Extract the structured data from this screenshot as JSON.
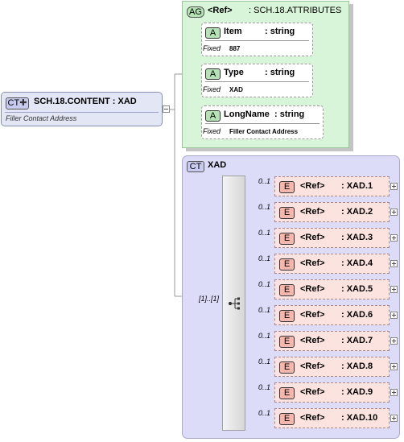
{
  "root": {
    "badge": "CT",
    "name": "SCH.18.CONTENT : XAD",
    "doc": "Filler Contact Address"
  },
  "attributes_group": {
    "badge": "AG",
    "ref": "<Ref>",
    "name": ": SCH.18.ATTRIBUTES",
    "attributes": [
      {
        "badge": "A",
        "name": "Item",
        "type": ": string",
        "fixed_label": "Fixed",
        "fixed_value": "887"
      },
      {
        "badge": "A",
        "name": "Type",
        "type": ": string",
        "fixed_label": "Fixed",
        "fixed_value": "XAD"
      },
      {
        "badge": "A",
        "name": "LongName",
        "type": ": string",
        "fixed_label": "Fixed",
        "fixed_value": "Filler Contact Address"
      }
    ]
  },
  "complex_type": {
    "badge": "CT",
    "name": "XAD",
    "sequence_multiplicity": "[1]..[1]",
    "elements": [
      {
        "badge": "E",
        "ref": "<Ref>",
        "name": ": XAD.1",
        "mult": "0..1"
      },
      {
        "badge": "E",
        "ref": "<Ref>",
        "name": ": XAD.2",
        "mult": "0..1"
      },
      {
        "badge": "E",
        "ref": "<Ref>",
        "name": ": XAD.3",
        "mult": "0..1"
      },
      {
        "badge": "E",
        "ref": "<Ref>",
        "name": ": XAD.4",
        "mult": "0..1"
      },
      {
        "badge": "E",
        "ref": "<Ref>",
        "name": ": XAD.5",
        "mult": "0..1"
      },
      {
        "badge": "E",
        "ref": "<Ref>",
        "name": ": XAD.6",
        "mult": "0..1"
      },
      {
        "badge": "E",
        "ref": "<Ref>",
        "name": ": XAD.7",
        "mult": "0..1"
      },
      {
        "badge": "E",
        "ref": "<Ref>",
        "name": ": XAD.8",
        "mult": "0..1"
      },
      {
        "badge": "E",
        "ref": "<Ref>",
        "name": ": XAD.9",
        "mult": "0..1"
      },
      {
        "badge": "E",
        "ref": "<Ref>",
        "name": ": XAD.10",
        "mult": "0..1"
      }
    ]
  },
  "colors": {
    "root_fill": "#e3e6f5",
    "group_fill": "#d9f5d9",
    "attr_fill": "#ffffff",
    "ct_fill": "#dcdcf8",
    "element_fill": "#fde3df",
    "attr_badge": "#b5e3b5",
    "element_badge": "#f6b8ae",
    "ct_badge": "#c8cbf0"
  }
}
